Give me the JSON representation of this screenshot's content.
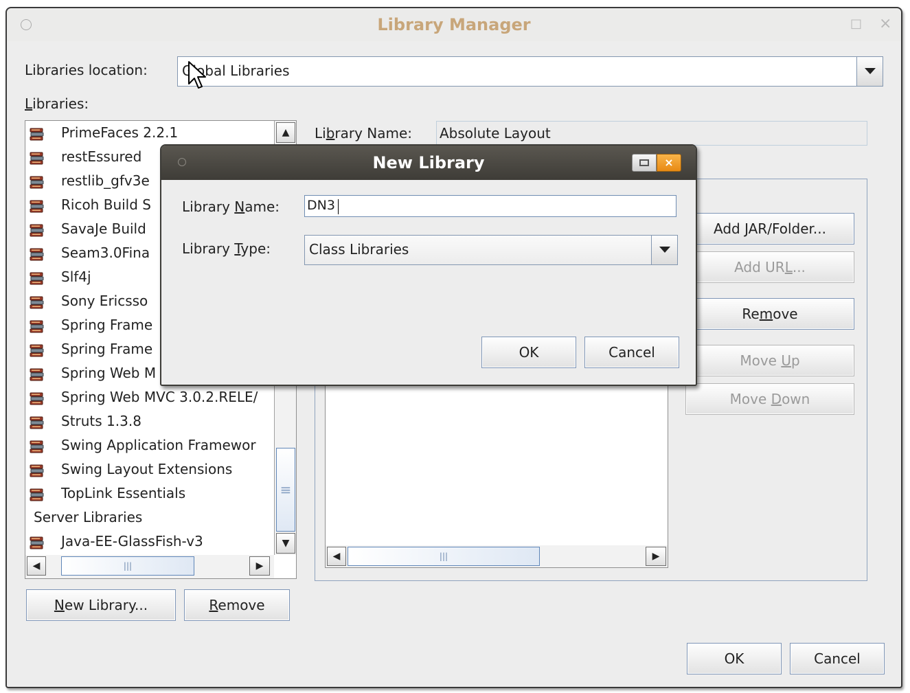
{
  "window": {
    "title": "Library Manager",
    "minimize_glyph": "□",
    "close_glyph": "×"
  },
  "location": {
    "label": "Libraries location:",
    "value": "Global Libraries"
  },
  "libraries": {
    "label_first": "L",
    "label_rest": "ibraries:",
    "items": [
      {
        "type": "library",
        "name": "PrimeFaces 2.2.1"
      },
      {
        "type": "library",
        "name": "restEssured"
      },
      {
        "type": "library",
        "name": "restlib_gfv3e"
      },
      {
        "type": "library",
        "name": "Ricoh Build S"
      },
      {
        "type": "library",
        "name": "SavaJe Build"
      },
      {
        "type": "library",
        "name": "Seam3.0Fina"
      },
      {
        "type": "library",
        "name": "Slf4j"
      },
      {
        "type": "library",
        "name": "Sony Ericsso"
      },
      {
        "type": "library",
        "name": "Spring Frame"
      },
      {
        "type": "library",
        "name": "Spring Frame"
      },
      {
        "type": "library",
        "name": "Spring Web M"
      },
      {
        "type": "library",
        "name": "Spring Web MVC 3.0.2.RELE/"
      },
      {
        "type": "library",
        "name": "Struts 1.3.8"
      },
      {
        "type": "library",
        "name": "Swing Application Framewor"
      },
      {
        "type": "library",
        "name": "Swing Layout Extensions"
      },
      {
        "type": "library",
        "name": "TopLink Essentials"
      },
      {
        "type": "category",
        "name": "Server Libraries"
      },
      {
        "type": "library",
        "name": "Java-EE-GlassFish-v3"
      }
    ],
    "scroll_left": "◀",
    "scroll_right": "▶",
    "scroll_up": "▲",
    "scroll_down": "▼",
    "grip": "|||",
    "grip_v": "≡"
  },
  "detail": {
    "name_label_pre": "Li",
    "name_label_u": "b",
    "name_label_post": "rary Name:",
    "name_value": "Absolute Layout",
    "grip": "|||"
  },
  "side_buttons": {
    "add_jar_pre": "Add ",
    "add_jar_u": "J",
    "add_jar_post": "AR/Folder...",
    "add_url_pre": "Add UR",
    "add_url_u": "L",
    "add_url_post": "...",
    "remove_pre": "Re",
    "remove_u": "m",
    "remove_post": "ove",
    "move_up_pre": "Move ",
    "move_up_u": "U",
    "move_up_post": "p",
    "move_down_pre": "Move ",
    "move_down_u": "D",
    "move_down_post": "own"
  },
  "bottom": {
    "new_library_u": "N",
    "new_library_rest": "ew Library...",
    "remove_u": "R",
    "remove_rest": "emove",
    "ok": "OK",
    "cancel": "Cancel"
  },
  "dialog": {
    "title": "New Library",
    "close_glyph": "×",
    "name_label_pre": "Library ",
    "name_label_u": "N",
    "name_label_post": "ame:",
    "name_value": "DN3",
    "type_label_pre": "Library ",
    "type_label_u": "T",
    "type_label_post": "ype:",
    "type_value": "Class Libraries",
    "ok": "OK",
    "cancel": "Cancel"
  }
}
